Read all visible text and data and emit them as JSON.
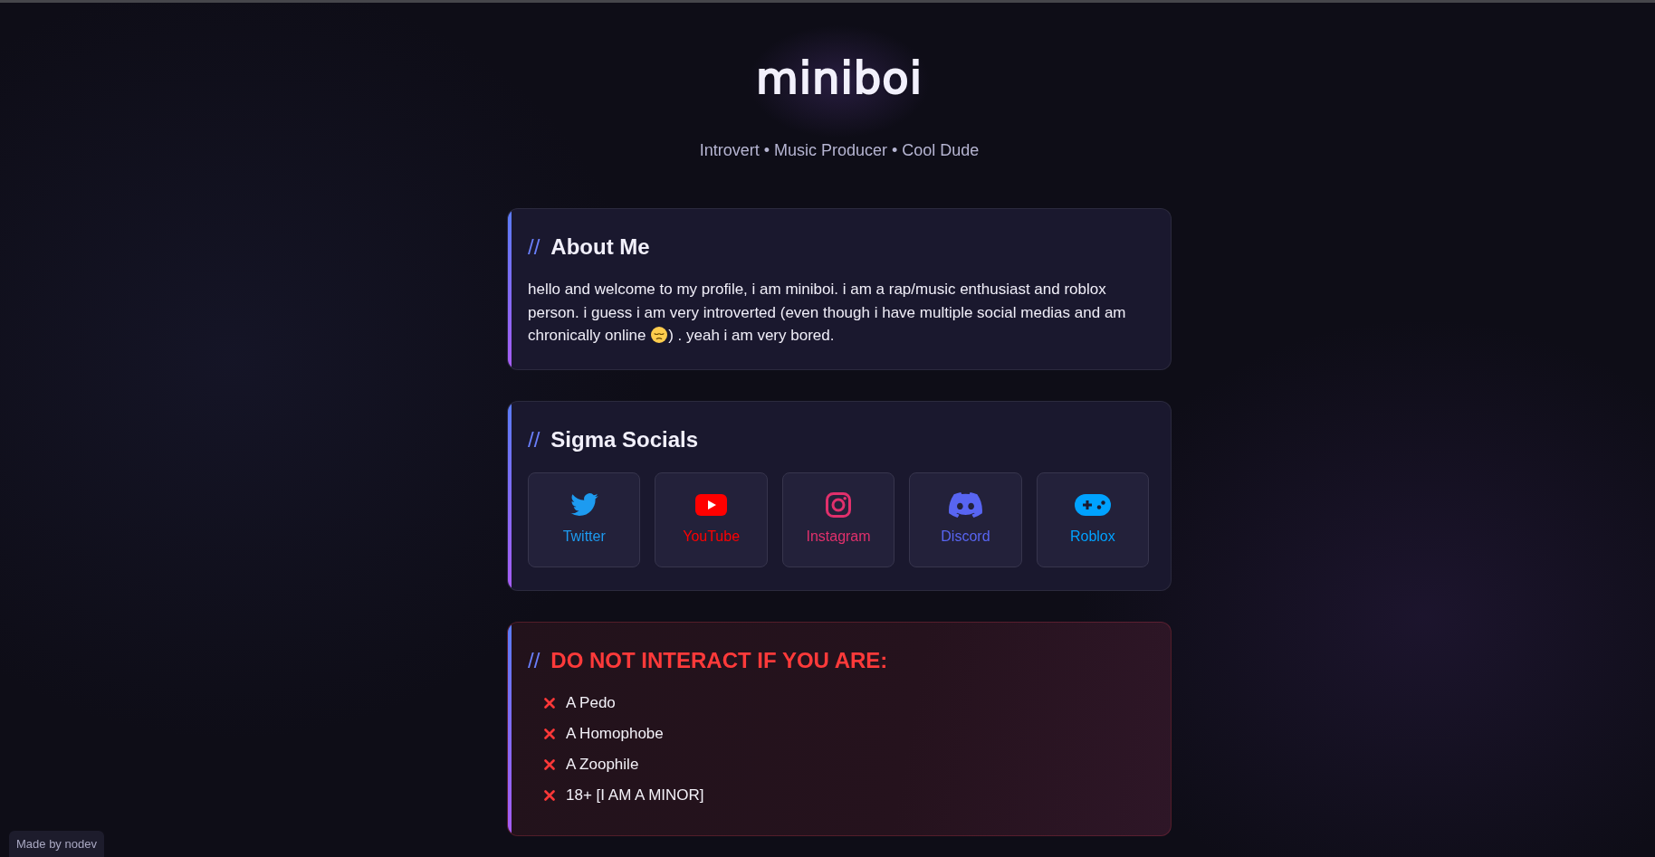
{
  "header": {
    "title": "miniboi",
    "subtitle": "Introvert • Music Producer • Cool Dude"
  },
  "sections": [
    {
      "kind": "text",
      "marker": "//",
      "title": "About Me",
      "body_parts": [
        "hello and welcome to my profile, i am miniboi. i am a rap/music enthusiast and roblox person. i guess i am very introverted (even though i have multiple social medias and am chronically online ",
        ") . yeah i am very bored."
      ]
    },
    {
      "kind": "links",
      "marker": "//",
      "title": "Sigma Socials",
      "links": [
        {
          "kind": "bird",
          "label": "Twitter",
          "color": "#1d9bf0"
        },
        {
          "kind": "play",
          "label": "YouTube",
          "color": "#ff0000"
        },
        {
          "kind": "camera",
          "label": "Instagram",
          "color": "#e1306c"
        },
        {
          "kind": "discord",
          "label": "Discord",
          "color": "#5865f2"
        },
        {
          "kind": "gamepad",
          "label": "Roblox",
          "color": "#00a2ff"
        }
      ]
    },
    {
      "kind": "warning",
      "marker": "//",
      "title": "DO NOT INTERACT IF YOU ARE:",
      "items": [
        "A Pedo",
        "A Homophobe",
        "A Zoophile",
        "18+ [I AM A MINOR]"
      ]
    }
  ],
  "credit": "Made by nodev"
}
